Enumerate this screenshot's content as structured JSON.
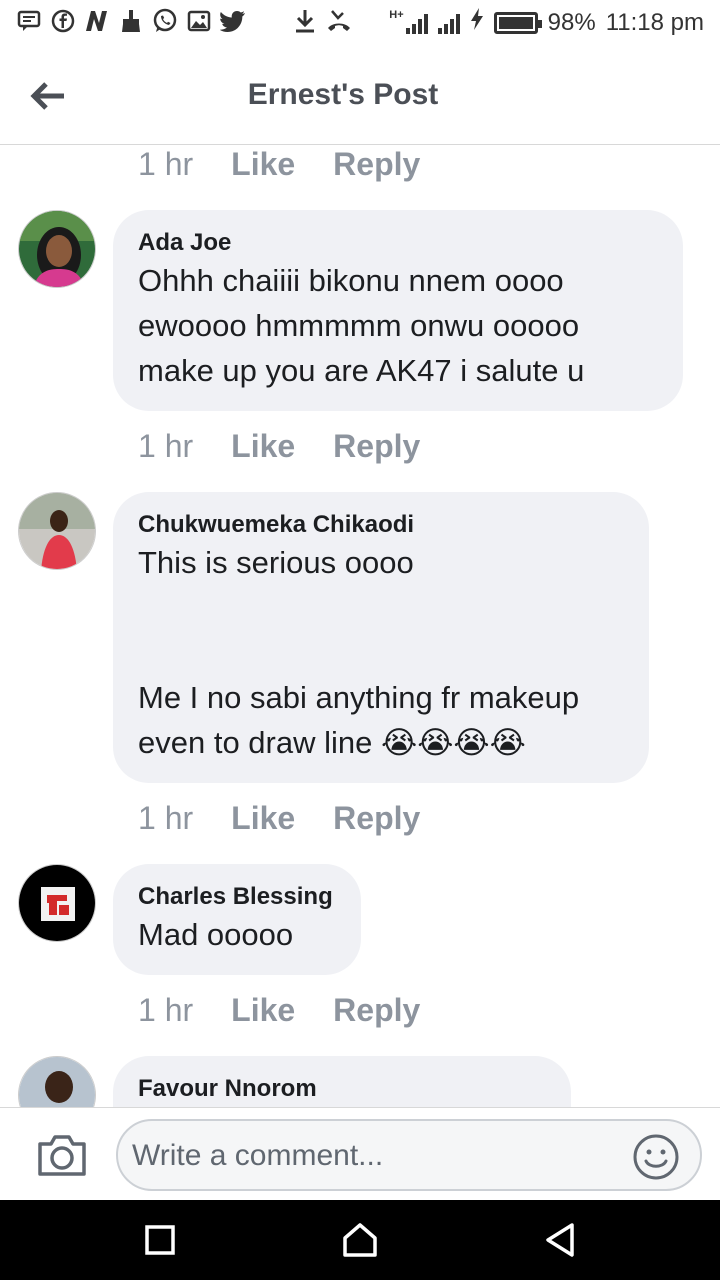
{
  "status_bar": {
    "battery": "98%",
    "time": "11:18 pm",
    "network": "H+",
    "icons": [
      "message-icon",
      "facebook-icon",
      "n-icon",
      "cleaner-icon",
      "whatsapp-icon",
      "gallery-icon",
      "twitter-icon",
      "download-icon",
      "missed-call-icon",
      "signal-icon",
      "charging-icon",
      "battery-icon"
    ]
  },
  "header": {
    "title": "Ernest's Post",
    "back_icon": "arrow-left-icon"
  },
  "comments": [
    {
      "id": "top-partial",
      "meta": {
        "time": "1 hr",
        "like": "Like",
        "reply": "Reply"
      }
    },
    {
      "author": "Ada Joe",
      "text": "Ohhh chaiiii bikonu nnem oooo\newoooo hmmmmm  onwu ooooo\nmake up you are AK47 i salute u",
      "meta": {
        "time": "1 hr",
        "like": "Like",
        "reply": "Reply"
      }
    },
    {
      "author": "Chukwuemeka Chikaodi",
      "text": "This is serious oooo\n\n\nMe I no sabi anything fr makeup\neven to draw line 😭😭😭😭",
      "meta": {
        "time": "1 hr",
        "like": "Like",
        "reply": "Reply"
      }
    },
    {
      "author": "Charles Blessing",
      "text": "Mad ooooo",
      "meta": {
        "time": "1 hr",
        "like": "Like",
        "reply": "Reply"
      }
    },
    {
      "author": "Favour Nnorom"
    }
  ],
  "composer": {
    "placeholder": "Write a comment...",
    "camera_icon": "camera-icon",
    "emoji_icon": "smiley-icon"
  },
  "navbar": {
    "icons": [
      "recent-apps-icon",
      "home-icon",
      "back-icon"
    ]
  }
}
